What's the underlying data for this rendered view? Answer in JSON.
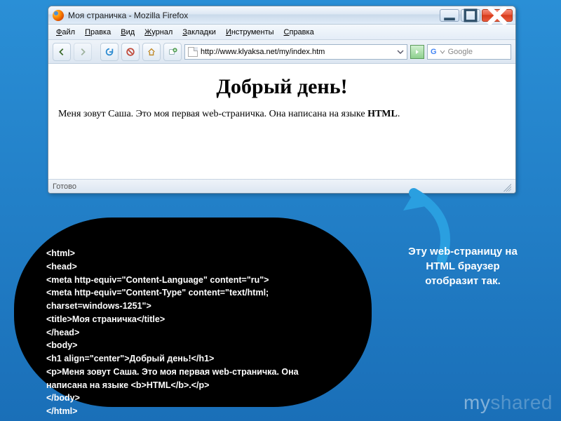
{
  "browser": {
    "title": "Моя страничка - Mozilla Firefox",
    "menu": [
      "Файл",
      "Правка",
      "Вид",
      "Журнал",
      "Закладки",
      "Инструменты",
      "Справка"
    ],
    "url": "http://www.klyaksa.net/my/index.htm",
    "search_placeholder": "Google",
    "status": "Готово"
  },
  "page": {
    "heading": "Добрый день!",
    "paragraph_prefix": "Меня зовут Саша. Это моя первая web-страничка. Она написана на языке ",
    "paragraph_bold": "HTML",
    "paragraph_suffix": "."
  },
  "code_lines": [
    "<html>",
    "<head>",
    "<meta http-equiv=\"Content-Language\" content=\"ru\">",
    "<meta http-equiv=\"Content-Type\" content=\"text/html; charset=windows-1251\">",
    "<title>Моя страничка</title>",
    "</head>",
    "<body>",
    "<h1 align=\"center\">Добрый день!</h1>",
    "<p>Меня зовут Саша. Это моя первая web-страничка. Она написана на языке <b>HTML</b>.</p>",
    "</body>",
    "</html>"
  ],
  "caption": "Эту web-страницу на HTML браузер отобразит так.",
  "watermark": {
    "a": "my",
    "b": "shared"
  }
}
